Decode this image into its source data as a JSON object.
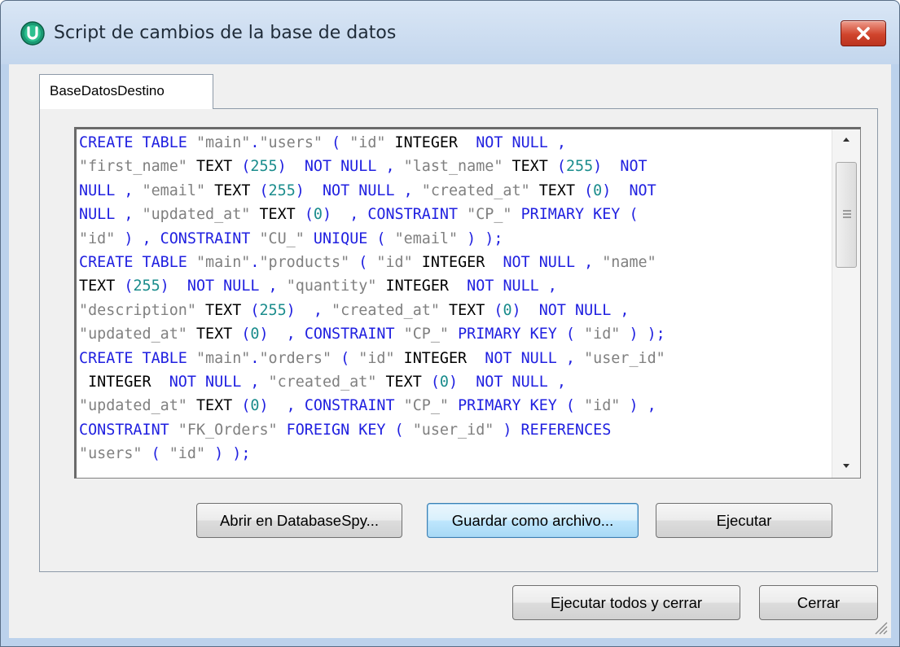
{
  "window": {
    "title": "Script de cambios de la base de datos",
    "app_icon": "altova-u-icon",
    "close_icon": "close-x-icon"
  },
  "tabs": [
    {
      "label": "BaseDatosDestino",
      "selected": true
    }
  ],
  "editor": {
    "language": "SQL",
    "lines": [
      [
        [
          "kw",
          "CREATE TABLE "
        ],
        [
          "str",
          "\"main\""
        ],
        [
          "kw",
          "."
        ],
        [
          "str",
          "\"users\""
        ],
        [
          "kw",
          " ( "
        ],
        [
          "str",
          "\"id\""
        ],
        [
          "typ",
          " INTEGER  "
        ],
        [
          "kw",
          "NOT NULL ,"
        ]
      ],
      [
        [
          "str",
          "\"first_name\""
        ],
        [
          "typ",
          " TEXT "
        ],
        [
          "kw",
          "("
        ],
        [
          "num",
          "255"
        ],
        [
          "kw",
          ")  NOT NULL , "
        ],
        [
          "str",
          "\"last_name\""
        ],
        [
          "typ",
          " TEXT "
        ],
        [
          "kw",
          "("
        ],
        [
          "num",
          "255"
        ],
        [
          "kw",
          ")  NOT"
        ]
      ],
      [
        [
          "kw",
          "NULL , "
        ],
        [
          "str",
          "\"email\""
        ],
        [
          "typ",
          " TEXT "
        ],
        [
          "kw",
          "("
        ],
        [
          "num",
          "255"
        ],
        [
          "kw",
          ")  NOT NULL , "
        ],
        [
          "str",
          "\"created_at\""
        ],
        [
          "typ",
          " TEXT "
        ],
        [
          "kw",
          "("
        ],
        [
          "num",
          "0"
        ],
        [
          "kw",
          ")  NOT"
        ]
      ],
      [
        [
          "kw",
          "NULL , "
        ],
        [
          "str",
          "\"updated_at\""
        ],
        [
          "typ",
          " TEXT "
        ],
        [
          "kw",
          "("
        ],
        [
          "num",
          "0"
        ],
        [
          "kw",
          ")  , CONSTRAINT "
        ],
        [
          "str",
          "\"CP_\""
        ],
        [
          "kw",
          " PRIMARY KEY ("
        ]
      ],
      [
        [
          "str",
          "\"id\""
        ],
        [
          "kw",
          " ) , CONSTRAINT "
        ],
        [
          "str",
          "\"CU_\""
        ],
        [
          "kw",
          " UNIQUE ( "
        ],
        [
          "str",
          "\"email\""
        ],
        [
          "kw",
          " ) );"
        ]
      ],
      [
        [
          "kw",
          "CREATE TABLE "
        ],
        [
          "str",
          "\"main\""
        ],
        [
          "kw",
          "."
        ],
        [
          "str",
          "\"products\""
        ],
        [
          "kw",
          " ( "
        ],
        [
          "str",
          "\"id\""
        ],
        [
          "typ",
          " INTEGER  "
        ],
        [
          "kw",
          "NOT NULL , "
        ],
        [
          "str",
          "\"name\""
        ]
      ],
      [
        [
          "typ",
          "TEXT "
        ],
        [
          "kw",
          "("
        ],
        [
          "num",
          "255"
        ],
        [
          "kw",
          ")  NOT NULL , "
        ],
        [
          "str",
          "\"quantity\""
        ],
        [
          "typ",
          " INTEGER  "
        ],
        [
          "kw",
          "NOT NULL ,"
        ]
      ],
      [
        [
          "str",
          "\"description\""
        ],
        [
          "typ",
          " TEXT "
        ],
        [
          "kw",
          "("
        ],
        [
          "num",
          "255"
        ],
        [
          "kw",
          ")  , "
        ],
        [
          "str",
          "\"created_at\""
        ],
        [
          "typ",
          " TEXT "
        ],
        [
          "kw",
          "("
        ],
        [
          "num",
          "0"
        ],
        [
          "kw",
          ")  NOT NULL ,"
        ]
      ],
      [
        [
          "str",
          "\"updated_at\""
        ],
        [
          "typ",
          " TEXT "
        ],
        [
          "kw",
          "("
        ],
        [
          "num",
          "0"
        ],
        [
          "kw",
          ")  , CONSTRAINT "
        ],
        [
          "str",
          "\"CP_\""
        ],
        [
          "kw",
          " PRIMARY KEY ( "
        ],
        [
          "str",
          "\"id\""
        ],
        [
          "kw",
          " ) );"
        ]
      ],
      [
        [
          "kw",
          "CREATE TABLE "
        ],
        [
          "str",
          "\"main\""
        ],
        [
          "kw",
          "."
        ],
        [
          "str",
          "\"orders\""
        ],
        [
          "kw",
          " ( "
        ],
        [
          "str",
          "\"id\""
        ],
        [
          "typ",
          " INTEGER  "
        ],
        [
          "kw",
          "NOT NULL , "
        ],
        [
          "str",
          "\"user_id\""
        ]
      ],
      [
        [
          "typ",
          " INTEGER  "
        ],
        [
          "kw",
          "NOT NULL , "
        ],
        [
          "str",
          "\"created_at\""
        ],
        [
          "typ",
          " TEXT "
        ],
        [
          "kw",
          "("
        ],
        [
          "num",
          "0"
        ],
        [
          "kw",
          ")  NOT NULL ,"
        ]
      ],
      [
        [
          "str",
          "\"updated_at\""
        ],
        [
          "typ",
          " TEXT "
        ],
        [
          "kw",
          "("
        ],
        [
          "num",
          "0"
        ],
        [
          "kw",
          ")  , CONSTRAINT "
        ],
        [
          "str",
          "\"CP_\""
        ],
        [
          "kw",
          " PRIMARY KEY ( "
        ],
        [
          "str",
          "\"id\""
        ],
        [
          "kw",
          " ) ,"
        ]
      ],
      [
        [
          "kw",
          "CONSTRAINT "
        ],
        [
          "str",
          "\"FK_Orders\""
        ],
        [
          "kw",
          " FOREIGN KEY ( "
        ],
        [
          "str",
          "\"user_id\""
        ],
        [
          "kw",
          " ) REFERENCES"
        ]
      ],
      [
        [
          "str",
          "\"users\""
        ],
        [
          "kw",
          " ( "
        ],
        [
          "str",
          "\"id\""
        ],
        [
          "kw",
          " ) );"
        ]
      ]
    ],
    "scrollbar_icons": {
      "up": "scroll-up-arrow-icon",
      "down": "scroll-down-arrow-icon",
      "grip": "scroll-grip-icon"
    }
  },
  "tab_buttons": {
    "open_in_databasespy": "Abrir en DatabaseSpy...",
    "save_as_file": "Guardar como archivo...",
    "execute": "Ejecutar"
  },
  "footer_buttons": {
    "execute_all_and_close": "Ejecutar todos y cerrar",
    "close": "Cerrar"
  },
  "colors": {
    "keyword": "#2020e0",
    "string": "#808080",
    "number": "#1a8c8c",
    "type": "#000000"
  }
}
